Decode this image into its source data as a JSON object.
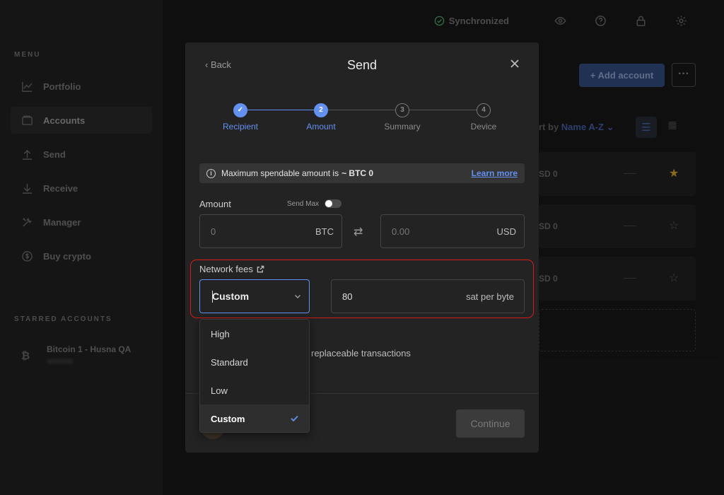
{
  "window": {
    "controls": [
      "close",
      "minimize",
      "maximize"
    ]
  },
  "sidebar": {
    "menu_title": "MENU",
    "items": [
      {
        "label": "Portfolio",
        "icon": "chart-icon"
      },
      {
        "label": "Accounts",
        "icon": "wallet-icon",
        "active": true
      },
      {
        "label": "Send",
        "icon": "arrow-up-icon"
      },
      {
        "label": "Receive",
        "icon": "arrow-down-icon"
      },
      {
        "label": "Manager",
        "icon": "tools-icon"
      },
      {
        "label": "Buy crypto",
        "icon": "dollar-coin-icon"
      }
    ],
    "starred_title": "STARRED ACCOUNTS",
    "starred": [
      {
        "name": "Bitcoin 1 - Husna QA",
        "icon": "bitcoin-icon"
      }
    ]
  },
  "topbar": {
    "sync_status": "Synchronized",
    "icons": [
      "eye-icon",
      "help-icon",
      "lock-icon",
      "settings-icon"
    ]
  },
  "background": {
    "add_account_label": "+ Add account",
    "more_label": "···",
    "sort_prefix": "rt by",
    "sort_value": "Name A-Z",
    "rows": [
      {
        "balance": "SD 0",
        "starred": true
      },
      {
        "balance": "SD 0",
        "starred": false
      },
      {
        "balance": "SD 0",
        "starred": false
      }
    ]
  },
  "modal": {
    "back_label": "Back",
    "title": "Send",
    "steps": [
      {
        "number": "✓",
        "label": "Recipient",
        "state": "done"
      },
      {
        "number": "2",
        "label": "Amount",
        "state": "current"
      },
      {
        "number": "3",
        "label": "Summary",
        "state": "todo"
      },
      {
        "number": "4",
        "label": "Device",
        "state": "todo"
      }
    ],
    "info": {
      "text": "Maximum spendable amount is ",
      "amount": "~ BTC 0",
      "link": "Learn more"
    },
    "amount": {
      "label": "Amount",
      "send_max_label": "Send Max",
      "send_max_on": false,
      "crypto_placeholder": "0",
      "crypto_unit": "BTC",
      "fiat_placeholder": "0.00",
      "fiat_unit": "USD"
    },
    "fees": {
      "label": "Network fees",
      "selected": "Custom",
      "rate_value": "80",
      "rate_unit": "sat per byte",
      "options": [
        "High",
        "Standard",
        "Low",
        "Custom"
      ]
    },
    "rbf_text": "replaceable transactions",
    "continue_label": "Continue"
  },
  "colors": {
    "accent": "#6490f1",
    "highlight_border": "#d81a1a",
    "star_active": "#b8912a"
  }
}
